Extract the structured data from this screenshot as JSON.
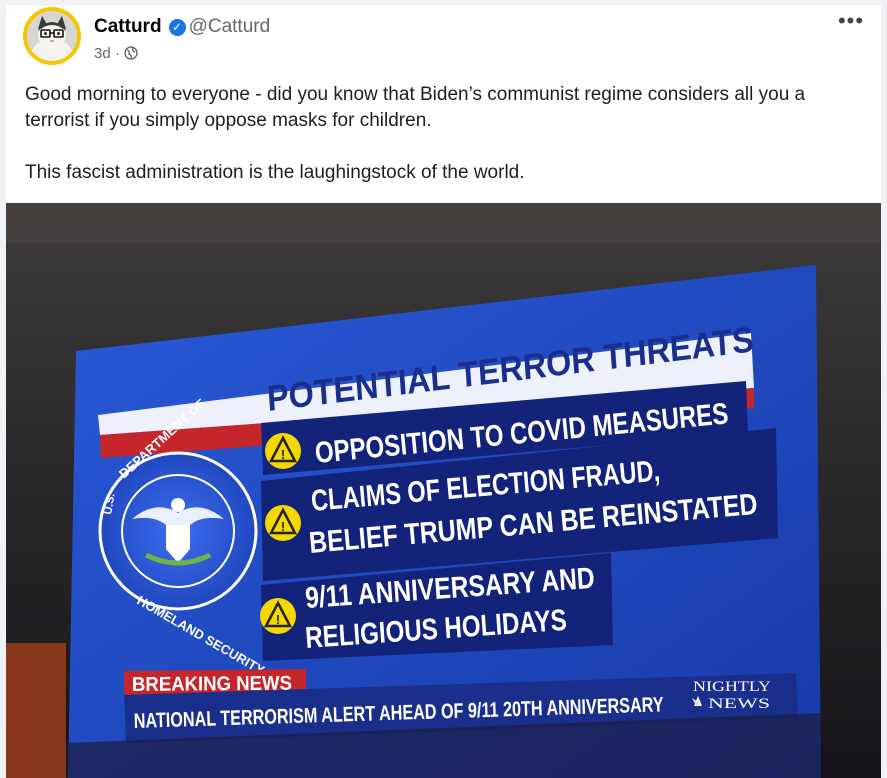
{
  "post": {
    "author": "Catturd",
    "handle": "@Catturd",
    "time": "3d",
    "separator": "·",
    "paragraphs": [
      "Good morning to everyone - did you know that Biden’s communist regime considers all you a terrorist if you simply oppose masks for children.",
      "This fascist administration is the laughingstock of the world."
    ],
    "more_label": "•••"
  },
  "icons": {
    "verified": "verified-badge-icon",
    "audience": "globe-icon",
    "more": "more-options-icon"
  },
  "image": {
    "headline": "POTENTIAL TERROR THREATS",
    "items": [
      [
        "OPPOSITION TO COVID MEASURES"
      ],
      [
        "CLAIMS OF ELECTION FRAUD,",
        "BELIEF TRUMP CAN BE REINSTATED"
      ],
      [
        "9/11 ANNIVERSARY AND",
        "RELIGIOUS HOLIDAYS"
      ]
    ],
    "seal_top": "DEPARTMENT OF",
    "seal_bottom": "HOMELAND SECURITY",
    "seal_left": "U.S.",
    "breaking_label": "BREAKING NEWS",
    "ticker": "NATIONAL TERRORISM ALERT AHEAD OF 9/11 20TH ANNIVERSARY",
    "network_line1": "NIGHTLY",
    "network_line2": "NEWS",
    "colors": {
      "screen_blue": "#1f49c8",
      "banner_red": "#c4262b",
      "item_navy": "#14237a",
      "warning_yellow": "#f4d800"
    }
  }
}
